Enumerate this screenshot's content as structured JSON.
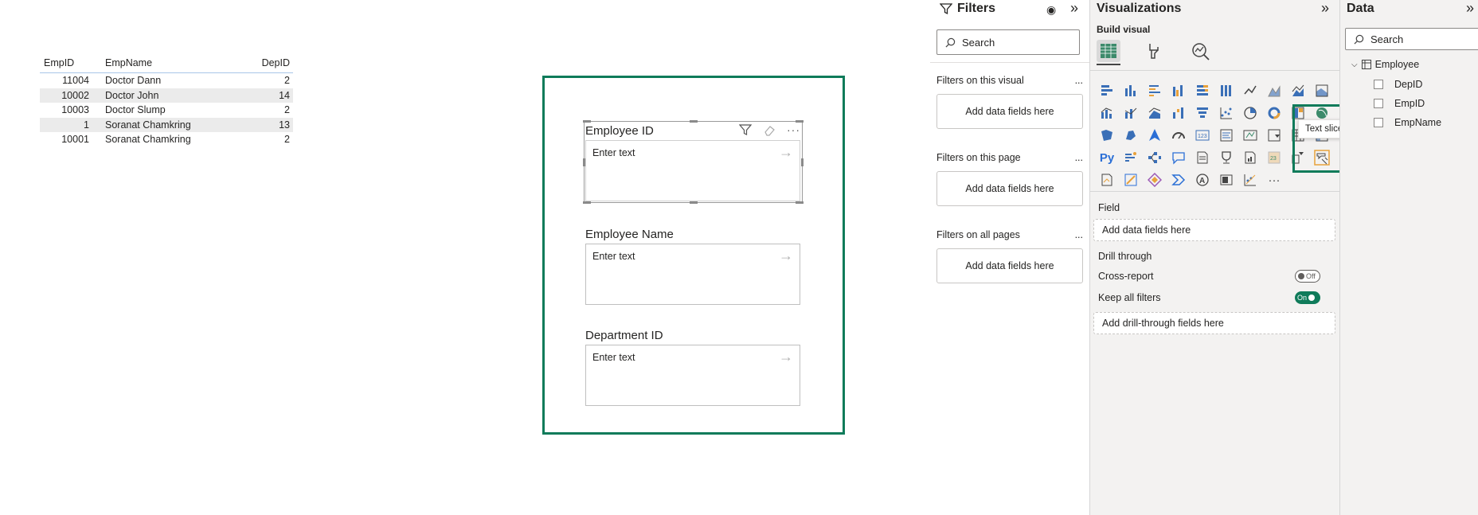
{
  "table": {
    "headers": [
      "EmpID",
      "EmpName",
      "DepID"
    ],
    "rows": [
      [
        "11004",
        "Doctor Dann",
        "2"
      ],
      [
        "10002",
        "Doctor John",
        "14"
      ],
      [
        "10003",
        "Doctor Slump",
        "2"
      ],
      [
        "1",
        "Soranat Chamkring",
        "13"
      ],
      [
        "10001",
        "Soranat Chamkring",
        "2"
      ]
    ]
  },
  "slicers": [
    {
      "title": "Employee ID",
      "placeholder": "Enter text"
    },
    {
      "title": "Employee Name",
      "placeholder": "Enter text"
    },
    {
      "title": "Department ID",
      "placeholder": "Enter text"
    }
  ],
  "filters": {
    "title": "Filters",
    "search_placeholder": "Search",
    "sections": [
      {
        "label": "Filters on this visual",
        "drop": "Add data fields here"
      },
      {
        "label": "Filters on this page",
        "drop": "Add data fields here"
      },
      {
        "label": "Filters on all pages",
        "drop": "Add data fields here"
      }
    ],
    "more": "..."
  },
  "visualizations": {
    "title": "Visualizations",
    "build_visual": "Build visual",
    "field_label": "Field",
    "field_drop": "Add data fields here",
    "drill_through": "Drill through",
    "cross_report": "Cross-report",
    "cross_report_state": "Off",
    "keep_all_filters": "Keep all filters",
    "keep_all_filters_state": "On",
    "drill_drop": "Add drill-through fields here",
    "tooltip": "Text slicer",
    "py_label": "Py",
    "ellipsis": "···"
  },
  "data_pane": {
    "title": "Data",
    "search_placeholder": "Search",
    "table_name": "Employee",
    "fields": [
      "DepID",
      "EmpID",
      "EmpName"
    ]
  },
  "colors": {
    "accent": "#0f7b5a",
    "viz_blue": "#3a6fb7",
    "viz_orange": "#e8a13a"
  }
}
